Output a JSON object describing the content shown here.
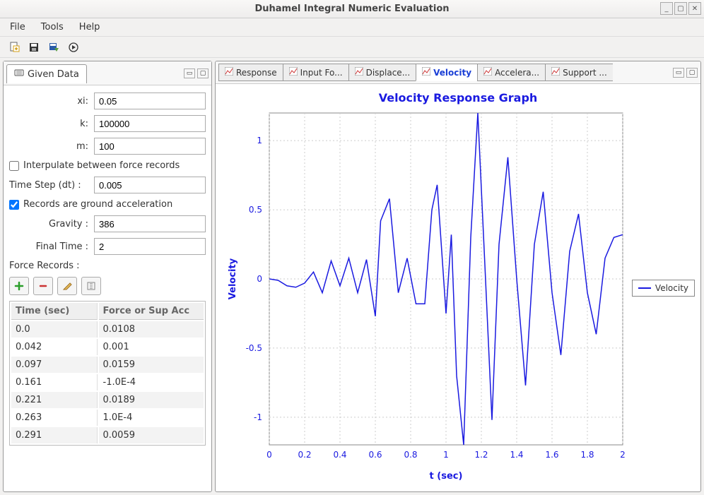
{
  "window": {
    "title": "Duhamel Integral Numeric Evaluation"
  },
  "menu": {
    "file": "File",
    "tools": "Tools",
    "help": "Help"
  },
  "left_panel": {
    "tab_label": "Given Data",
    "xi_label": "xi:",
    "xi_value": "0.05",
    "k_label": "k:",
    "k_value": "100000",
    "m_label": "m:",
    "m_value": "100",
    "interpolate_label": "Interpulate between force records",
    "interpolate_checked": false,
    "dt_label": "Time Step (dt) :",
    "dt_value": "0.005",
    "ground_accel_label": "Records are ground acceleration",
    "ground_accel_checked": true,
    "gravity_label": "Gravity :",
    "gravity_value": "386",
    "final_time_label": "Final Time :",
    "final_time_value": "2",
    "force_records_label": "Force Records :",
    "table_headers": {
      "time": "Time (sec)",
      "force": "Force or Sup Acc"
    },
    "records": [
      {
        "time": "0.0",
        "force": "0.0108"
      },
      {
        "time": "0.042",
        "force": "0.001"
      },
      {
        "time": "0.097",
        "force": "0.0159"
      },
      {
        "time": "0.161",
        "force": "-1.0E-4"
      },
      {
        "time": "0.221",
        "force": "0.0189"
      },
      {
        "time": "0.263",
        "force": "1.0E-4"
      },
      {
        "time": "0.291",
        "force": "0.0059"
      }
    ]
  },
  "tabs": [
    {
      "label": "Response",
      "active": false
    },
    {
      "label": "Input Fo...",
      "active": false
    },
    {
      "label": "Displace...",
      "active": false
    },
    {
      "label": "Velocity",
      "active": true
    },
    {
      "label": "Accelera...",
      "active": false
    },
    {
      "label": "Support ...",
      "active": false
    }
  ],
  "chart": {
    "title": "Velocity Response Graph",
    "xlabel": "t (sec)",
    "ylabel": "Velocity",
    "legend": "Velocity"
  },
  "chart_data": {
    "type": "line",
    "title": "Velocity Response Graph",
    "xlabel": "t (sec)",
    "ylabel": "Velocity",
    "xlim": [
      0,
      2
    ],
    "ylim": [
      -1.2,
      1.2
    ],
    "xticks": [
      0,
      0.2,
      0.4,
      0.6,
      0.8,
      1,
      1.2,
      1.4,
      1.6,
      1.8,
      2
    ],
    "yticks": [
      -1,
      -0.5,
      0,
      0.5,
      1
    ],
    "series": [
      {
        "name": "Velocity",
        "color": "#1a1ae0",
        "x": [
          0,
          0.05,
          0.1,
          0.15,
          0.2,
          0.25,
          0.3,
          0.35,
          0.4,
          0.45,
          0.5,
          0.55,
          0.6,
          0.63,
          0.68,
          0.73,
          0.78,
          0.83,
          0.88,
          0.92,
          0.95,
          1.0,
          1.03,
          1.06,
          1.1,
          1.14,
          1.18,
          1.22,
          1.26,
          1.3,
          1.35,
          1.4,
          1.45,
          1.5,
          1.55,
          1.6,
          1.65,
          1.7,
          1.75,
          1.8,
          1.85,
          1.9,
          1.95,
          2.0
        ],
        "y": [
          0.0,
          -0.01,
          -0.05,
          -0.06,
          -0.03,
          0.05,
          -0.1,
          0.13,
          -0.05,
          0.15,
          -0.1,
          0.14,
          -0.27,
          0.42,
          0.58,
          -0.1,
          0.15,
          -0.18,
          -0.18,
          0.5,
          0.68,
          -0.25,
          0.32,
          -0.7,
          -1.2,
          0.3,
          1.2,
          0.1,
          -1.02,
          0.25,
          0.88,
          0.0,
          -0.77,
          0.25,
          0.63,
          -0.1,
          -0.55,
          0.2,
          0.47,
          -0.1,
          -0.4,
          0.15,
          0.3,
          0.32
        ]
      }
    ]
  }
}
